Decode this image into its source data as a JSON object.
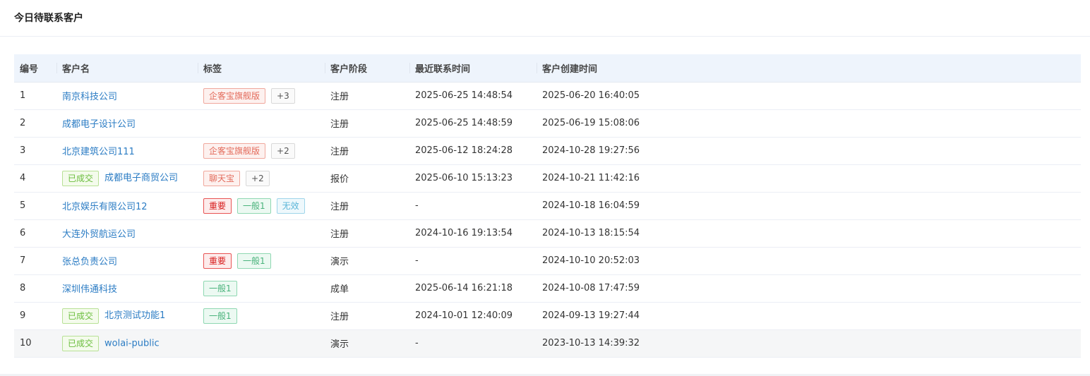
{
  "panel": {
    "title": "今日待联系客户"
  },
  "table": {
    "columns": [
      "编号",
      "客户名",
      "标签",
      "客户阶段",
      "最近联系时间",
      "客户创建时间"
    ],
    "rows": [
      {
        "id": "1",
        "deal": "",
        "name": "南京科技公司",
        "tags": [
          {
            "text": "企客宝旗舰版",
            "style": "orange"
          },
          {
            "text": "+3",
            "style": "more"
          }
        ],
        "stage": "注册",
        "last_contact": "2025-06-25 14:48:54",
        "created": "2025-06-20 16:40:05"
      },
      {
        "id": "2",
        "deal": "",
        "name": "成都电子设计公司",
        "tags": [],
        "stage": "注册",
        "last_contact": "2025-06-25 14:48:59",
        "created": "2025-06-19 15:08:06"
      },
      {
        "id": "3",
        "deal": "",
        "name": "北京建筑公司111",
        "tags": [
          {
            "text": "企客宝旗舰版",
            "style": "orange"
          },
          {
            "text": "+2",
            "style": "more"
          }
        ],
        "stage": "注册",
        "last_contact": "2025-06-12 18:24:28",
        "created": "2024-10-28 19:27:56"
      },
      {
        "id": "4",
        "deal": "已成交",
        "name": "成都电子商贸公司",
        "tags": [
          {
            "text": "聊天宝",
            "style": "orange"
          },
          {
            "text": "+2",
            "style": "more"
          }
        ],
        "stage": "报价",
        "last_contact": "2025-06-10 15:13:23",
        "created": "2024-10-21 11:42:16"
      },
      {
        "id": "5",
        "deal": "",
        "name": "北京娱乐有限公司12",
        "tags": [
          {
            "text": "重要",
            "style": "red"
          },
          {
            "text": "一般1",
            "style": "green"
          },
          {
            "text": "无效",
            "style": "cyan"
          }
        ],
        "stage": "注册",
        "last_contact": "-",
        "created": "2024-10-18 16:04:59"
      },
      {
        "id": "6",
        "deal": "",
        "name": "大连外贸航运公司",
        "tags": [],
        "stage": "注册",
        "last_contact": "2024-10-16 19:13:54",
        "created": "2024-10-13 18:15:54"
      },
      {
        "id": "7",
        "deal": "",
        "name": "张总负责公司",
        "tags": [
          {
            "text": "重要",
            "style": "red"
          },
          {
            "text": "一般1",
            "style": "green"
          }
        ],
        "stage": "演示",
        "last_contact": "-",
        "created": "2024-10-10 20:52:03"
      },
      {
        "id": "8",
        "deal": "",
        "name": "深圳伟通科技",
        "tags": [
          {
            "text": "一般1",
            "style": "green"
          }
        ],
        "stage": "成单",
        "last_contact": "2025-06-14 16:21:18",
        "created": "2024-10-08 17:47:59"
      },
      {
        "id": "9",
        "deal": "已成交",
        "name": "北京测试功能1",
        "tags": [
          {
            "text": "一般1",
            "style": "green"
          }
        ],
        "stage": "注册",
        "last_contact": "2024-10-01 12:40:09",
        "created": "2024-09-13 19:27:44"
      },
      {
        "id": "10",
        "deal": "已成交",
        "name": "wolai-public",
        "tags": [],
        "stage": "演示",
        "last_contact": "-",
        "created": "2023-10-13 14:39:32"
      }
    ]
  },
  "colors": {
    "link": "#2b7cc4",
    "header_bg": "#eef4fc",
    "tag_orange": "#e36b5b",
    "tag_red": "#d81e1e",
    "tag_green": "#48b27a",
    "tag_cyan": "#5ab5d8",
    "tag_deal": "#6abd3c"
  }
}
